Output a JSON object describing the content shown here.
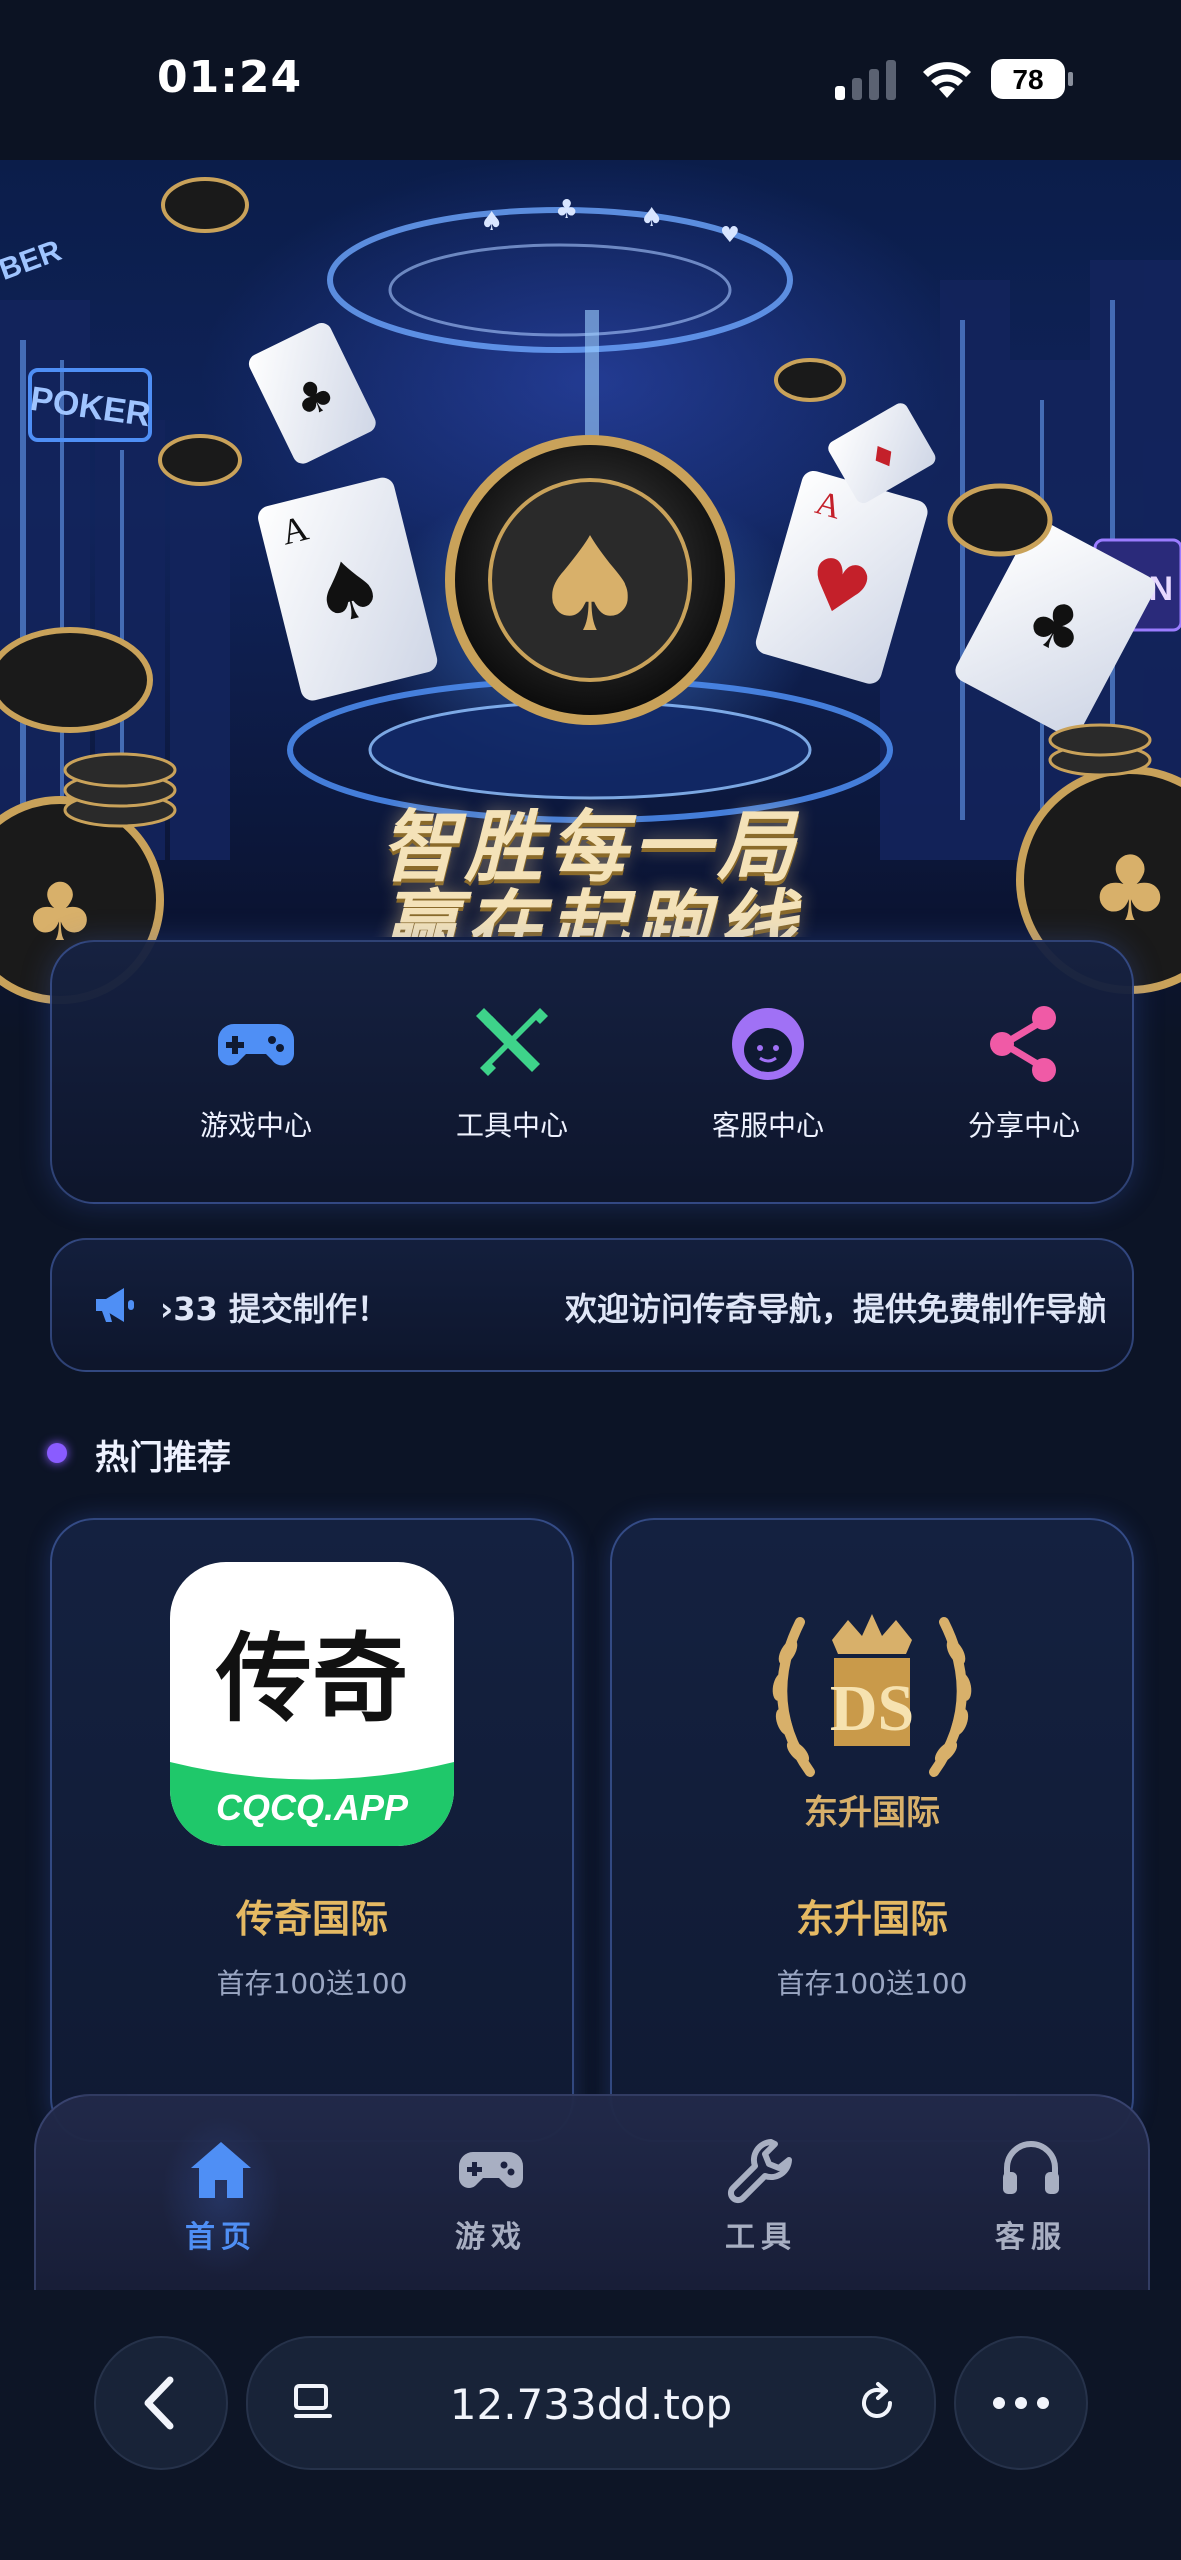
{
  "status_bar": {
    "time": "01:24",
    "battery": "78"
  },
  "hero": {
    "slogan_line1": "智胜每一局",
    "slogan_line2": "赢在起跑线",
    "sign_poker": "POKER",
    "sign_win": "WIN",
    "sign_ber": "BER"
  },
  "quick_links": [
    {
      "label": "游戏中心",
      "icon": "gamepad-icon",
      "color": "#4f8ff5"
    },
    {
      "label": "工具中心",
      "icon": "tools-icon",
      "color": "#3ed38a"
    },
    {
      "label": "客服中心",
      "icon": "support-agent-icon",
      "color": "#a071f5"
    },
    {
      "label": "分享中心",
      "icon": "share-icon",
      "color": "#f05aa6"
    }
  ],
  "notice": {
    "text_a": "›33 提交制作！",
    "text_b": "欢迎访问传奇导航，提供免费制作导航"
  },
  "section": {
    "title": "热门推荐"
  },
  "cards": [
    {
      "name": "传奇国际",
      "desc": "首存100送100",
      "logo_text": "传奇",
      "logo_sub": "CQCQ.APP"
    },
    {
      "name": "东升国际",
      "desc": "首存100送100",
      "logo_text": "东升国际",
      "logo_mono": "DS"
    }
  ],
  "tabbar": [
    {
      "label": "首页",
      "icon": "home-icon",
      "active": true
    },
    {
      "label": "游戏",
      "icon": "gamepad-icon",
      "active": false
    },
    {
      "label": "工具",
      "icon": "wrench-icon",
      "active": false
    },
    {
      "label": "客服",
      "icon": "headset-icon",
      "active": false
    }
  ],
  "browser": {
    "url": "12.733dd.top"
  },
  "colors": {
    "accent": "#4f8ff5",
    "gold": "#e5b963",
    "background": "#0c1426"
  }
}
